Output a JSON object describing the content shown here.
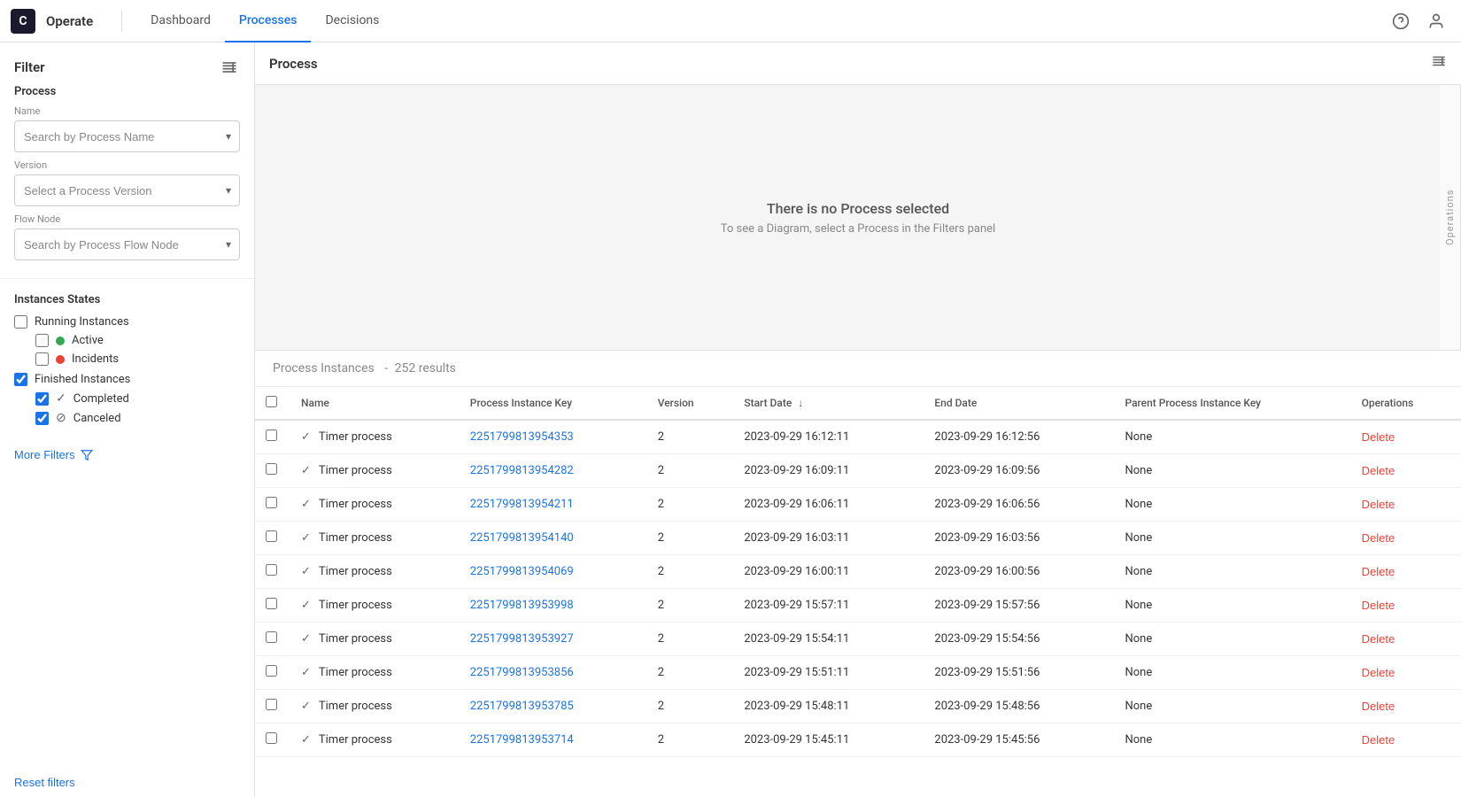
{
  "app": {
    "logo": "C",
    "name": "Operate"
  },
  "nav": {
    "links": [
      {
        "id": "dashboard",
        "label": "Dashboard",
        "active": false
      },
      {
        "id": "processes",
        "label": "Processes",
        "active": true
      },
      {
        "id": "decisions",
        "label": "Decisions",
        "active": false
      }
    ],
    "help_icon": "?",
    "user_icon": "👤"
  },
  "sidebar": {
    "title": "Filter",
    "toggle_icon": "⊞",
    "process_section": {
      "title": "Process",
      "name_label": "Name",
      "name_placeholder": "Search by Process Name",
      "version_label": "Version",
      "version_placeholder": "Select a Process Version",
      "flow_node_label": "Flow Node",
      "flow_node_placeholder": "Search by Process Flow Node"
    },
    "instances_states": {
      "title": "Instances States",
      "running_label": "Running Instances",
      "running_checked": false,
      "active_label": "Active",
      "active_checked": false,
      "incidents_label": "Incidents",
      "incidents_checked": false,
      "finished_label": "Finished Instances",
      "finished_checked": true,
      "completed_label": "Completed",
      "completed_checked": true,
      "canceled_label": "Canceled",
      "canceled_checked": true
    },
    "more_filters_label": "More Filters",
    "reset_label": "Reset filters"
  },
  "process_panel": {
    "title": "Process",
    "no_process_title": "There is no Process selected",
    "no_process_sub": "To see a Diagram, select a Process in the Filters panel",
    "operations_label": "Operations"
  },
  "instances_table": {
    "header": "Process Instances",
    "results_prefix": "-",
    "results_count": "252 results",
    "columns": [
      {
        "id": "select",
        "label": ""
      },
      {
        "id": "name",
        "label": "Name"
      },
      {
        "id": "key",
        "label": "Process Instance Key"
      },
      {
        "id": "version",
        "label": "Version"
      },
      {
        "id": "start_date",
        "label": "Start Date",
        "sortable": true,
        "sorted": true
      },
      {
        "id": "end_date",
        "label": "End Date"
      },
      {
        "id": "parent_key",
        "label": "Parent Process Instance Key"
      },
      {
        "id": "operations",
        "label": "Operations"
      }
    ],
    "rows": [
      {
        "name": "Timer process",
        "key": "2251799813954353",
        "version": "2",
        "start_date": "2023-09-29 16:12:11",
        "end_date": "2023-09-29 16:12:56",
        "parent_key": "None",
        "operation": "Delete"
      },
      {
        "name": "Timer process",
        "key": "2251799813954282",
        "version": "2",
        "start_date": "2023-09-29 16:09:11",
        "end_date": "2023-09-29 16:09:56",
        "parent_key": "None",
        "operation": "Delete"
      },
      {
        "name": "Timer process",
        "key": "2251799813954211",
        "version": "2",
        "start_date": "2023-09-29 16:06:11",
        "end_date": "2023-09-29 16:06:56",
        "parent_key": "None",
        "operation": "Delete"
      },
      {
        "name": "Timer process",
        "key": "2251799813954140",
        "version": "2",
        "start_date": "2023-09-29 16:03:11",
        "end_date": "2023-09-29 16:03:56",
        "parent_key": "None",
        "operation": "Delete"
      },
      {
        "name": "Timer process",
        "key": "2251799813954069",
        "version": "2",
        "start_date": "2023-09-29 16:00:11",
        "end_date": "2023-09-29 16:00:56",
        "parent_key": "None",
        "operation": "Delete"
      },
      {
        "name": "Timer process",
        "key": "2251799813953998",
        "version": "2",
        "start_date": "2023-09-29 15:57:11",
        "end_date": "2023-09-29 15:57:56",
        "parent_key": "None",
        "operation": "Delete"
      },
      {
        "name": "Timer process",
        "key": "2251799813953927",
        "version": "2",
        "start_date": "2023-09-29 15:54:11",
        "end_date": "2023-09-29 15:54:56",
        "parent_key": "None",
        "operation": "Delete"
      },
      {
        "name": "Timer process",
        "key": "2251799813953856",
        "version": "2",
        "start_date": "2023-09-29 15:51:11",
        "end_date": "2023-09-29 15:51:56",
        "parent_key": "None",
        "operation": "Delete"
      },
      {
        "name": "Timer process",
        "key": "2251799813953785",
        "version": "2",
        "start_date": "2023-09-29 15:48:11",
        "end_date": "2023-09-29 15:48:56",
        "parent_key": "None",
        "operation": "Delete"
      },
      {
        "name": "Timer process",
        "key": "2251799813953714",
        "version": "2",
        "start_date": "2023-09-29 15:45:11",
        "end_date": "2023-09-29 15:45:56",
        "parent_key": "None",
        "operation": "Delete"
      }
    ]
  }
}
